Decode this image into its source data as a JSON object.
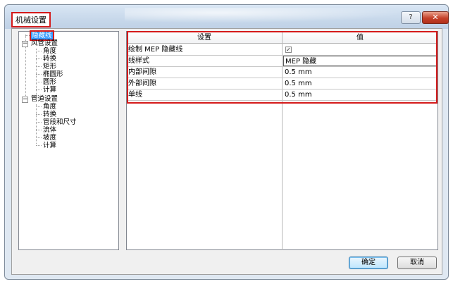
{
  "window": {
    "title": "机械设置",
    "help_glyph": "?",
    "close_glyph": "✕"
  },
  "tree": {
    "items": [
      {
        "label": "隐藏线",
        "level": 1,
        "selected": true
      },
      {
        "label": "风管设置",
        "level": 0,
        "expander": "−"
      },
      {
        "label": "角度",
        "level": 1
      },
      {
        "label": "转换",
        "level": 1
      },
      {
        "label": "矩形",
        "level": 1
      },
      {
        "label": "椭圆形",
        "level": 1
      },
      {
        "label": "圆形",
        "level": 1
      },
      {
        "label": "计算",
        "level": 1
      },
      {
        "label": "管道设置",
        "level": 0,
        "expander": "−"
      },
      {
        "label": "角度",
        "level": 1
      },
      {
        "label": "转换",
        "level": 1
      },
      {
        "label": "管段和尺寸",
        "level": 1
      },
      {
        "label": "流体",
        "level": 1
      },
      {
        "label": "坡度",
        "level": 1
      },
      {
        "label": "计算",
        "level": 1
      }
    ]
  },
  "grid": {
    "headers": {
      "setting": "设置",
      "value": "值"
    },
    "rows": [
      {
        "name": "绘制 MEP 隐藏线",
        "value": "",
        "checked": true,
        "check_glyph": "✓"
      },
      {
        "name": "线样式",
        "value": "MEP 隐藏"
      },
      {
        "name": "内部间隙",
        "value": "0.5 mm"
      },
      {
        "name": "外部间隙",
        "value": "0.5 mm"
      },
      {
        "name": "单线",
        "value": "0.5 mm"
      }
    ]
  },
  "buttons": {
    "ok": "确定",
    "cancel": "取消"
  },
  "colors": {
    "highlight": "#d41a1a",
    "selection": "#3399ff"
  }
}
